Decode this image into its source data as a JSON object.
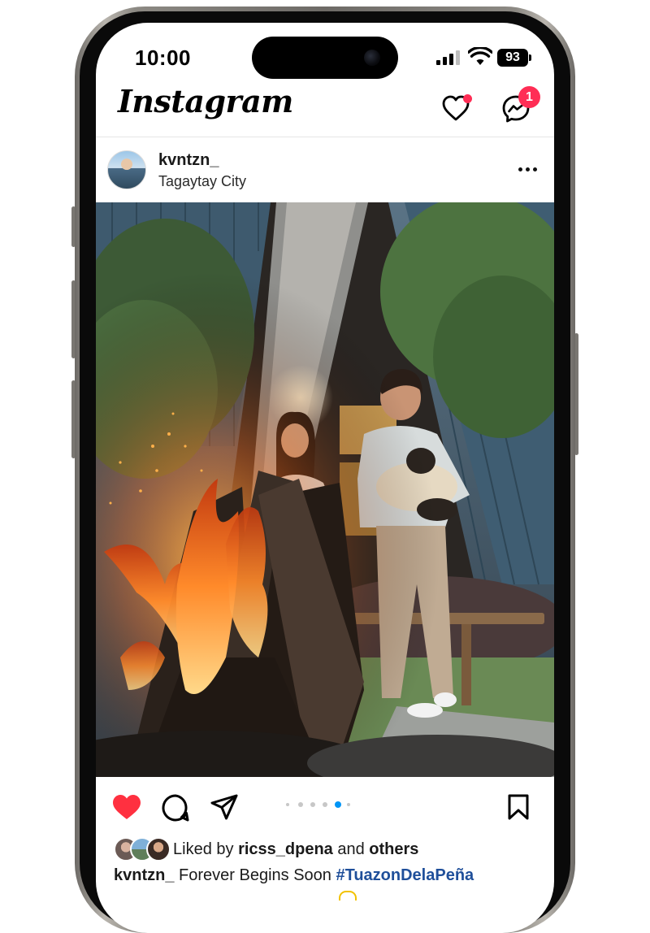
{
  "status_bar": {
    "time": "10:00",
    "battery": "93"
  },
  "app": {
    "logo_text": "Instagram",
    "notifications_badge": "1"
  },
  "post": {
    "username": "kvntzn_",
    "location": "Tagaytay City",
    "carousel": {
      "total": 6,
      "active_index": 4
    },
    "likes": {
      "prefix": "Liked by",
      "user": "ricss_dpena",
      "connector": "and",
      "others": "others"
    },
    "caption": {
      "user": "kvntzn_",
      "text": "Forever Begins Soon",
      "hashtag": "#TuazonDelaPeña"
    }
  },
  "colors": {
    "like_red": "#ff3040",
    "badge_red": "#ff2d55",
    "hashtag_blue": "#1f4f9a"
  },
  "icons": [
    "heart-icon",
    "messenger-icon",
    "more-icon",
    "like-icon",
    "comment-icon",
    "share-icon",
    "bookmark-icon"
  ]
}
